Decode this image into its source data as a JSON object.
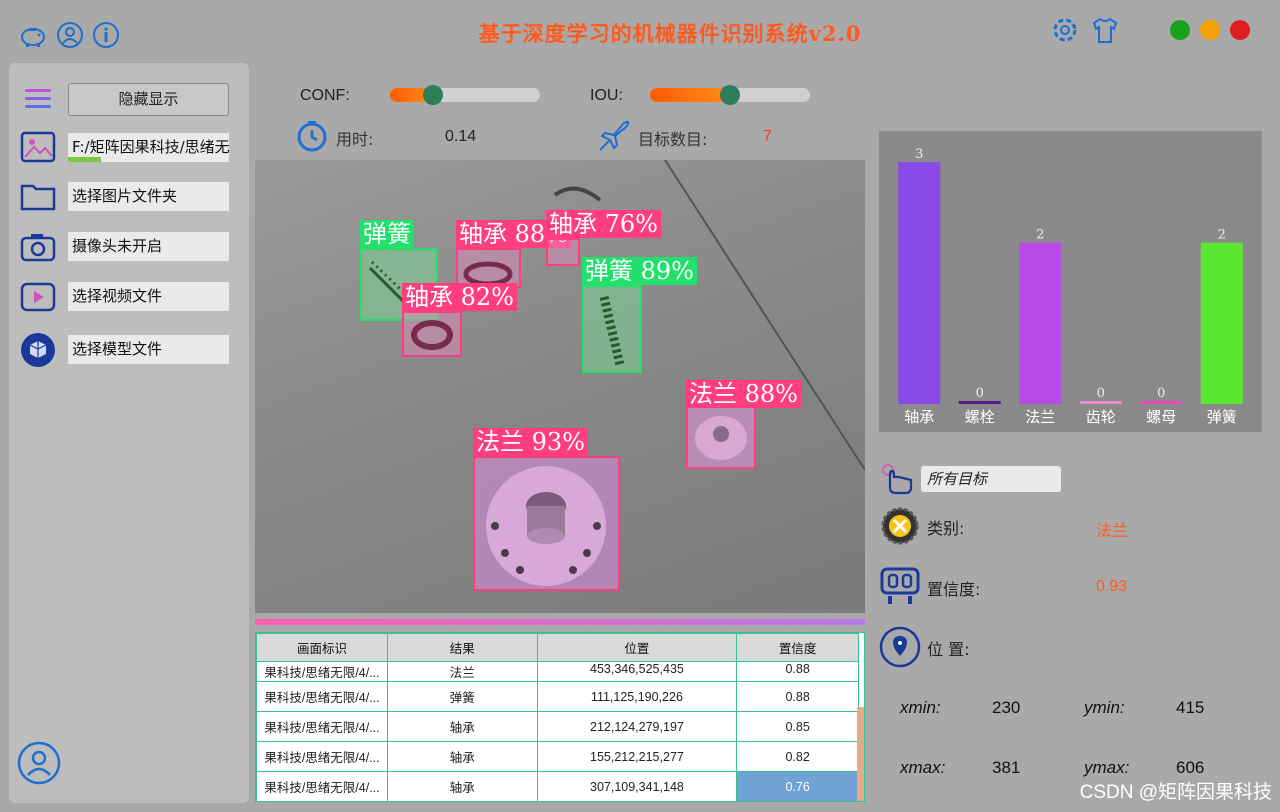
{
  "title": "基于深度学习的机械器件识别系统v2.0",
  "colors": {
    "accent": "#ff5a1f",
    "green_dot": "#1aa31a",
    "orange_dot": "#f5a300",
    "red_dot": "#e02020",
    "icon_blue": "#1f6fd1"
  },
  "top_icons": [
    "piggy-bank-icon",
    "user-icon",
    "info-icon"
  ],
  "top_right_icons": [
    "gear-icon",
    "tshirt-icon"
  ],
  "left_panel": {
    "hide_button": "隐藏显示",
    "items": [
      {
        "icon": "image-icon",
        "text": "F:/矩阵因果科技/思绪无限/4/..."
      },
      {
        "icon": "folder-icon",
        "text": "选择图片文件夹"
      },
      {
        "icon": "camera-icon",
        "text": "摄像头未开启"
      },
      {
        "icon": "video-icon",
        "text": "选择视频文件"
      },
      {
        "icon": "model-icon",
        "text": "选择模型文件"
      }
    ],
    "path_progress": 0.2
  },
  "controls": {
    "conf_label": "CONF:",
    "conf_value": 0.25,
    "iou_label": "IOU:",
    "iou_value": 0.5,
    "time_label": "用时:",
    "time_value": "0.14",
    "count_label": "目标数目:",
    "count_value": "7"
  },
  "detections": [
    {
      "label": "弹簧",
      "color": "#22e06b",
      "conf_text": ""
    },
    {
      "label": "轴承",
      "color": "#ff3d7f",
      "conf_text": "88%"
    },
    {
      "label": "轴承",
      "color": "#ff3d7f",
      "conf_text": "76%"
    },
    {
      "label": "弹簧",
      "color": "#22e06b",
      "conf_text": "89%"
    },
    {
      "label": "轴承",
      "color": "#ff3d7f",
      "conf_text": "82%"
    },
    {
      "label": "法兰",
      "color": "#ff3d7f",
      "conf_text": "88%"
    },
    {
      "label": "法兰",
      "color": "#ff3d7f",
      "conf_text": "93%"
    }
  ],
  "table": {
    "headers": [
      "画面标识",
      "结果",
      "位置",
      "置信度"
    ],
    "rows": [
      [
        "果科技/思绪无限/4/...",
        "法兰",
        "453,346,525,435",
        "0.88"
      ],
      [
        "果科技/思绪无限/4/...",
        "弹簧",
        "111,125,190,226",
        "0.88"
      ],
      [
        "果科技/思绪无限/4/...",
        "轴承",
        "212,124,279,197",
        "0.85"
      ],
      [
        "果科技/思绪无限/4/...",
        "轴承",
        "155,212,215,277",
        "0.82"
      ],
      [
        "果科技/思绪无限/4/...",
        "轴承",
        "307,109,341,148",
        "0.76"
      ]
    ]
  },
  "chart_data": {
    "type": "bar",
    "categories": [
      "轴承",
      "螺栓",
      "法兰",
      "齿轮",
      "螺母",
      "弹簧"
    ],
    "values": [
      3,
      0,
      2,
      0,
      0,
      2
    ],
    "colors": [
      "#8a4ae8",
      "#5a1a8a",
      "#b84ae8",
      "#e890d0",
      "#e84ab8",
      "#5ae830"
    ],
    "ylim": [
      0,
      3
    ]
  },
  "detail": {
    "target_select": "所有目标",
    "class_label": "类别:",
    "class_value": "法兰",
    "conf_label": "置信度:",
    "conf_value": "0.93",
    "pos_label": "位 置:",
    "xmin_label": "xmin:",
    "xmin": "230",
    "ymin_label": "ymin:",
    "ymin": "415",
    "xmax_label": "xmax:",
    "xmax": "381",
    "ymax_label": "ymax:",
    "ymax": "606"
  },
  "watermark": "CSDN @矩阵因果科技"
}
